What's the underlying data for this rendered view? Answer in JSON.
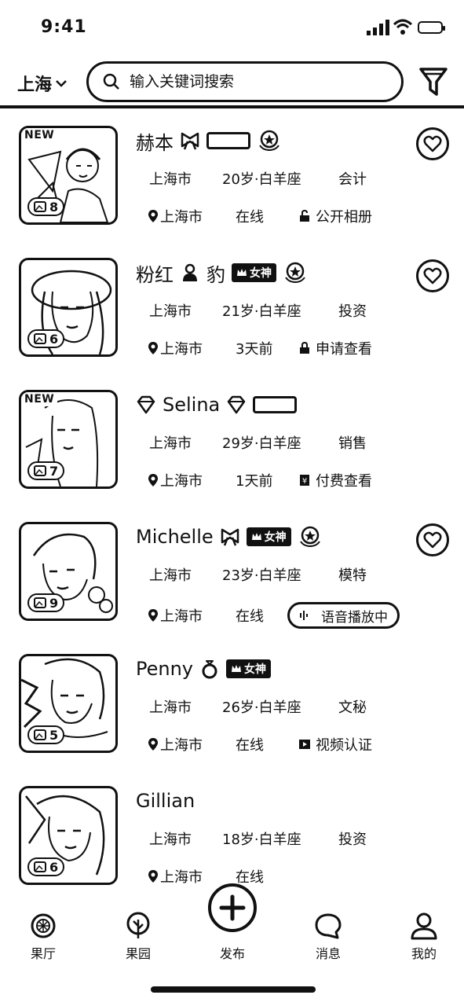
{
  "status_bar": {
    "time": "9:41"
  },
  "header": {
    "city": "上海",
    "search_placeholder": "输入关键词搜索"
  },
  "profiles": [
    {
      "name": "赫本",
      "is_new": true,
      "photo_count": "8",
      "city": "上海市",
      "age_sign": "20岁·白羊座",
      "job": "会计",
      "location": "上海市",
      "online": "在线",
      "extra_label": "公开相册",
      "extra_icon": "unlock-icon",
      "tags": [
        "bow-icon",
        "blank-tag",
        "crown-badge-icon"
      ],
      "has_heart": true
    },
    {
      "name": "粉红",
      "name_suffix": "豹",
      "is_new": false,
      "photo_count": "6",
      "city": "上海市",
      "age_sign": "21岁·白羊座",
      "job": "投资",
      "location": "上海市",
      "online": "3天前",
      "extra_label": "申请查看",
      "extra_icon": "lock-icon",
      "goddess_tag": "女神",
      "tags": [
        "goddess-tag",
        "crown-badge-icon"
      ],
      "has_heart": true
    },
    {
      "name": "Selina",
      "is_new": true,
      "photo_count": "7",
      "city": "上海市",
      "age_sign": "29岁·白羊座",
      "job": "销售",
      "location": "上海市",
      "online": "1天前",
      "extra_label": "付费查看",
      "extra_icon": "paid-icon",
      "tags": [
        "diamond-icon",
        "blank-tag"
      ],
      "has_heart": false
    },
    {
      "name": "Michelle",
      "is_new": false,
      "photo_count": "9",
      "city": "上海市",
      "age_sign": "23岁·白羊座",
      "job": "模特",
      "location": "上海市",
      "online": "在线",
      "extra_label": "语音播放中",
      "extra_icon": "voice-icon",
      "goddess_tag": "女神",
      "tags": [
        "bow-icon",
        "goddess-tag",
        "crown-badge-icon"
      ],
      "has_heart": true
    },
    {
      "name": "Penny",
      "is_new": false,
      "photo_count": "5",
      "city": "上海市",
      "age_sign": "26岁·白羊座",
      "job": "文秘",
      "location": "上海市",
      "online": "在线",
      "extra_label": "视频认证",
      "extra_icon": "video-icon",
      "goddess_tag": "女神",
      "tags": [
        "ring-icon",
        "goddess-tag"
      ],
      "has_heart": false
    },
    {
      "name": "Gillian",
      "is_new": false,
      "photo_count": "6",
      "city": "上海市",
      "age_sign": "18岁·白羊座",
      "job": "投资",
      "location": "上海市",
      "online": "在线",
      "extra_label": "",
      "tags": [],
      "has_heart": false
    }
  ],
  "tabbar": {
    "tabs": [
      {
        "label": "果厅",
        "icon": "lemon-icon"
      },
      {
        "label": "果园",
        "icon": "tree-icon"
      },
      {
        "label": "发布",
        "icon": "plus-icon"
      },
      {
        "label": "消息",
        "icon": "chat-icon"
      },
      {
        "label": "我的",
        "icon": "user-icon"
      }
    ]
  }
}
